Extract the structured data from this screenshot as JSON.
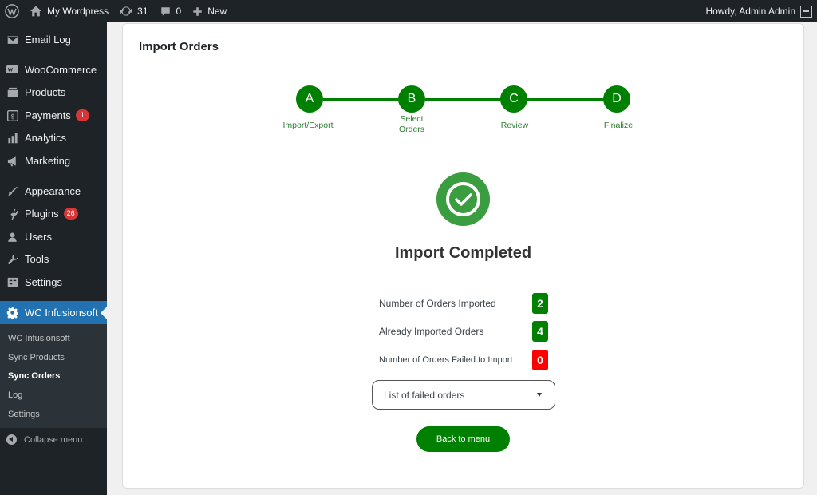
{
  "adminbar": {
    "site_name": "My Wordpress",
    "updates_count": "31",
    "comments_count": "0",
    "new_label": "New",
    "greeting": "Howdy, Admin Admin"
  },
  "sidebar": {
    "items": [
      {
        "label": "Email Log",
        "icon": "email-icon"
      },
      {
        "label": "WooCommerce",
        "icon": "woocommerce-icon"
      },
      {
        "label": "Products",
        "icon": "products-icon"
      },
      {
        "label": "Payments",
        "icon": "payments-icon",
        "badge": "1"
      },
      {
        "label": "Analytics",
        "icon": "analytics-icon"
      },
      {
        "label": "Marketing",
        "icon": "megaphone-icon"
      },
      {
        "label": "Appearance",
        "icon": "paintbrush-icon"
      },
      {
        "label": "Plugins",
        "icon": "plugin-icon",
        "badge": "26"
      },
      {
        "label": "Users",
        "icon": "users-icon"
      },
      {
        "label": "Tools",
        "icon": "wrench-icon"
      },
      {
        "label": "Settings",
        "icon": "settings-icon"
      },
      {
        "label": "WC Infusionsoft",
        "icon": "gear-icon"
      }
    ],
    "submenu": [
      "WC Infusionsoft",
      "Sync Products",
      "Sync Orders",
      "Log",
      "Settings"
    ],
    "collapse_label": "Collapse menu"
  },
  "main": {
    "title": "Import Orders",
    "steps": [
      {
        "letter": "A",
        "label": "Import/Export"
      },
      {
        "letter": "B",
        "label": "Select Orders"
      },
      {
        "letter": "C",
        "label": "Review"
      },
      {
        "letter": "D",
        "label": "Finalize"
      }
    ],
    "status_title": "Import Completed",
    "stats": [
      {
        "label": "Number of Orders Imported",
        "value": "2"
      },
      {
        "label": "Already Imported Orders",
        "value": "4"
      },
      {
        "label": "Number of Orders Failed to Import",
        "value": "0"
      }
    ],
    "failed_select": "List of failed orders",
    "back_button": "Back to menu"
  },
  "colors": {
    "accent_green": "#008000",
    "error_red": "#ff0000",
    "admin_dark": "#1d2327",
    "active_blue": "#2271b1"
  }
}
